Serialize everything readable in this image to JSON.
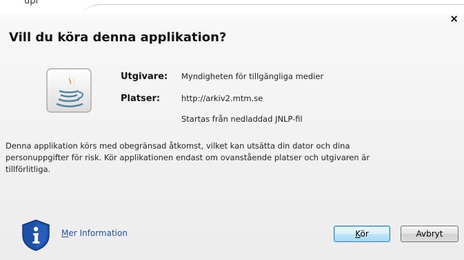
{
  "window": {
    "top_fragment": "upl",
    "close_glyph": "×"
  },
  "dialog": {
    "title": "Vill du köra denna applikation?",
    "publisher_label": "Utgivare:",
    "publisher_value": "Myndigheten för tillgängliga medier",
    "locations_label": "Platser:",
    "location_value": "http://arkiv2.mtm.se",
    "launch_note": "Startas från nedladdad JNLP-fil",
    "description_line1": "Denna applikation körs med obegränsad åtkomst, vilket kan utsätta din dator och dina",
    "description_line2": "personuppgifter för risk. Kör applikationen endast om ovanstående platser och utgivaren är",
    "description_line3": "tillförlitliga.",
    "more_info_first": "M",
    "more_info_rest": "er Information",
    "run_first": "K",
    "run_rest": "ör",
    "cancel_label": "Avbryt"
  },
  "icons": {
    "app": "java-coffee-cup-icon",
    "info": "shield-info-icon"
  },
  "colors": {
    "link": "#224f9c",
    "primary_button_border": "#3c7fb1",
    "shield": "#1c4fa8"
  }
}
